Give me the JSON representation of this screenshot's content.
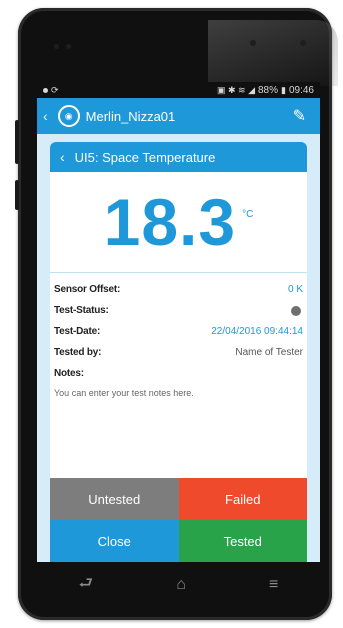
{
  "status_bar": {
    "battery": "88%",
    "time": "09:46"
  },
  "app_bar": {
    "title": "Merlin_Nizza01",
    "app_icon": "app-logo-icon",
    "edit_icon": "pencil-icon"
  },
  "card": {
    "title": "UI5: Space Temperature",
    "value": "18.3",
    "unit": "°C",
    "rows": {
      "sensor_offset_label": "Sensor Offset:",
      "sensor_offset_value": "0 K",
      "test_status_label": "Test-Status:",
      "test_date_label": "Test-Date:",
      "test_date_value": "22/04/2016 09:44:14",
      "tested_by_label": "Tested by:",
      "tested_by_value": "Name of Tester",
      "notes_label": "Notes:",
      "notes_placeholder": "You can enter your test notes here."
    }
  },
  "buttons": {
    "untested": "Untested",
    "failed": "Failed",
    "close": "Close",
    "tested": "Tested"
  },
  "colors": {
    "accent": "#1e98d8",
    "failed": "#ef4a2b",
    "tested": "#29a34a",
    "untested": "#7d7d7d"
  }
}
